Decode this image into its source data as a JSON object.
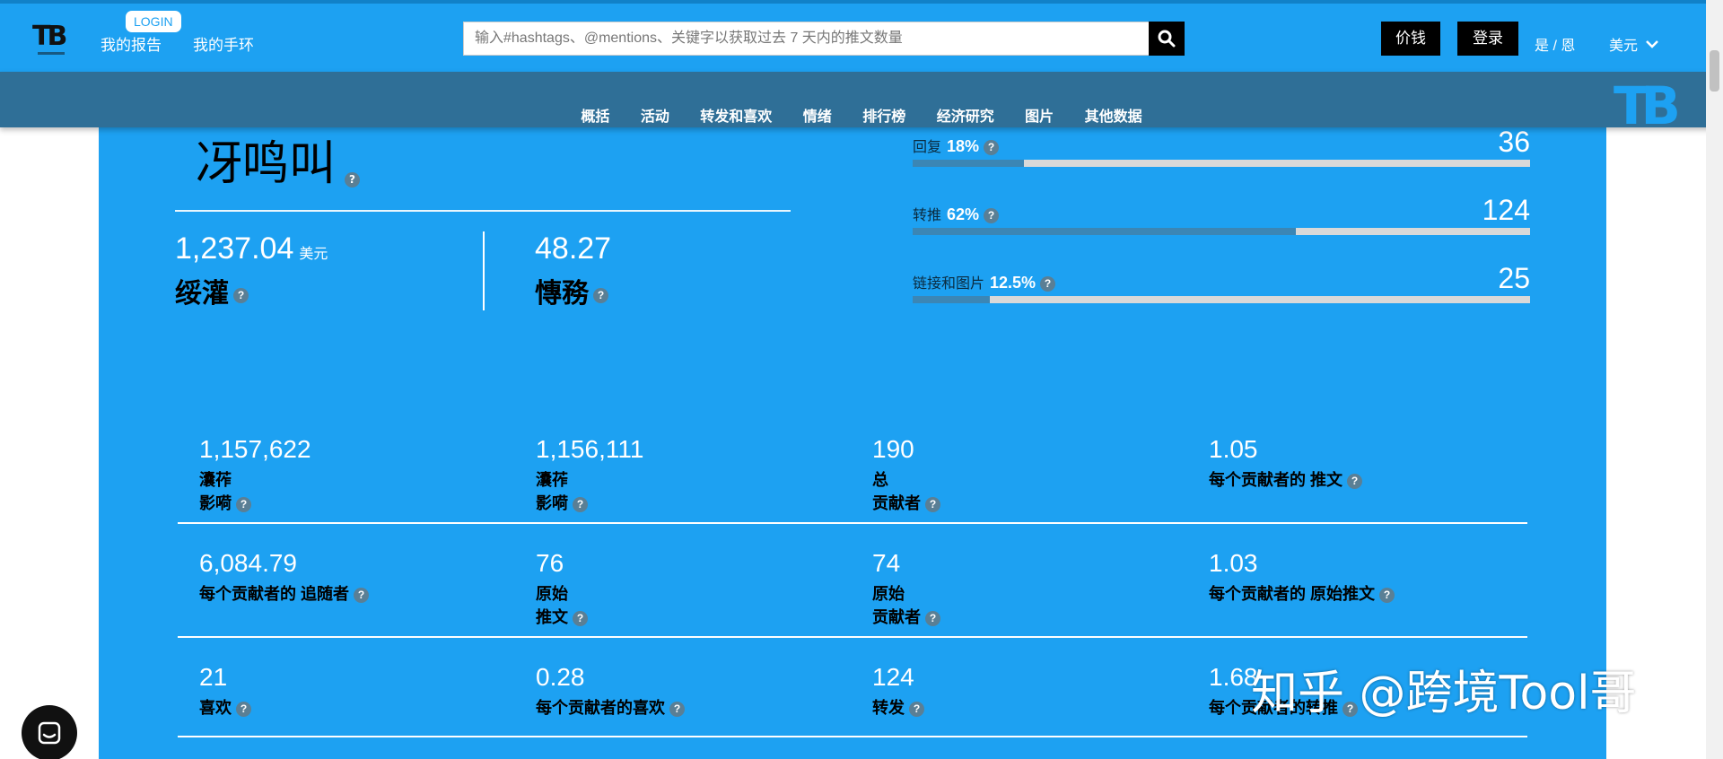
{
  "header": {
    "login_badge": "LOGIN",
    "my_reports": "我的报告",
    "my_tracker": "我的手环",
    "search_placeholder": "输入#hashtags、@mentions、关键字以获取过去 7 天内的推文数量",
    "pricing": "价钱",
    "signin": "登录",
    "language": "是 / 恩",
    "currency": "美元"
  },
  "nav": {
    "items": [
      "概括",
      "活动",
      "转发和喜欢",
      "情绪",
      "排行榜",
      "经济研究",
      "图片",
      "其他数据"
    ]
  },
  "summary": {
    "big_title": "冴鸣叫",
    "value1": "1,237.04",
    "value1_unit": "美元",
    "label1": "绥灌",
    "value2": "48.27",
    "label2": "慱務"
  },
  "progress": [
    {
      "label": "回复",
      "percent": "18%",
      "fill": 0.18,
      "count": "36"
    },
    {
      "label": "转推",
      "percent": "62%",
      "fill": 0.62,
      "count": "124"
    },
    {
      "label": "链接和图片",
      "percent": "12.5%",
      "fill": 0.125,
      "count": "25"
    }
  ],
  "stats": [
    {
      "value": "1,157,622",
      "label": "灢莋\n影嗬"
    },
    {
      "value": "1,156,111",
      "label": "灢莋\n影嗬"
    },
    {
      "value": "190",
      "label": "总\n贡献者"
    },
    {
      "value": "1.05",
      "label": "每个贡献者的 推文"
    },
    {
      "value": "6,084.79",
      "label": "每个贡献者的 追随者"
    },
    {
      "value": "76",
      "label": "原始\n推文"
    },
    {
      "value": "74",
      "label": "原始\n贡献者"
    },
    {
      "value": "1.03",
      "label": "每个贡献者的 原始推文"
    },
    {
      "value": "21",
      "label": "喜欢"
    },
    {
      "value": "0.28",
      "label": "每个贡献者的喜欢"
    },
    {
      "value": "124",
      "label": "转发"
    },
    {
      "value": "1.68",
      "label": "每个贡献者的转推"
    }
  ],
  "watermark": "知乎 @跨境Tool哥",
  "icons": {
    "search": "search-icon",
    "chevron": "chevron-down-icon",
    "chat": "chat-icon",
    "help": "question-icon"
  },
  "colors": {
    "brand_blue": "#1da1f2",
    "nav_bar": "#2f6f97",
    "bar_fill": "#3b86b5"
  }
}
